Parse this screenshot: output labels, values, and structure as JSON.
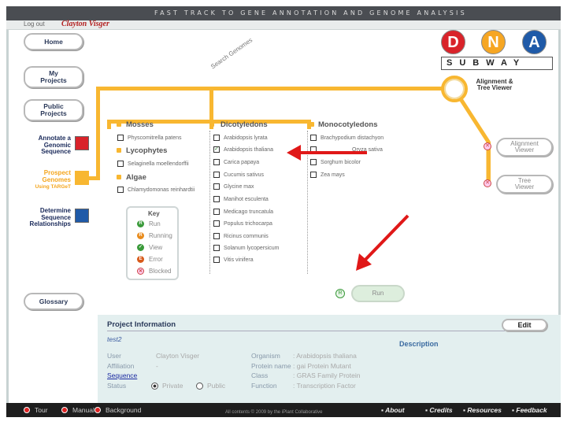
{
  "header": {
    "banner": "FAST TRACK TO GENE ANNOTATION AND GENOME ANALYSIS",
    "logout_label": "Log out",
    "username": "Clayton Visger"
  },
  "nav": {
    "home": "Home",
    "my_projects": "My Projects",
    "public_projects": "Public Projects",
    "glossary": "Glossary"
  },
  "tasks": {
    "annotate": "Annotate a Genomic Sequence",
    "prospect": "Prospect Genomes",
    "prospect_sub": "Using TARGeT",
    "determine": "Determine Sequence Relationships"
  },
  "logo": {
    "d": "D",
    "n": "N",
    "a": "A",
    "subway": "SUBWAY",
    "colors": {
      "d": "#d9232a",
      "n": "#f6a623",
      "a": "#1f5aa8"
    }
  },
  "search_genomes_label": "Search Genomes",
  "stations": {
    "alignment_tree": "Alignment & Tree Viewer",
    "alignment_viewer": "Alignment Viewer",
    "tree_viewer": "Tree Viewer"
  },
  "genomes": {
    "mosses": {
      "heading": "Mosses",
      "items": [
        {
          "label": "Physcomitrella patens",
          "checked": false
        }
      ]
    },
    "lycophytes": {
      "heading": "Lycophytes",
      "items": [
        {
          "label": "Selaginella moellendorffii",
          "checked": false
        }
      ]
    },
    "algae": {
      "heading": "Algae",
      "items": [
        {
          "label": "Chlamydomonas reinhardtii",
          "checked": false
        }
      ]
    },
    "dicotyledons": {
      "heading": "Dicotyledons",
      "items": [
        {
          "label": "Arabidopsis lyrata",
          "checked": false
        },
        {
          "label": "Arabidopsis thaliana",
          "checked": true
        },
        {
          "label": "Carica papaya",
          "checked": false
        },
        {
          "label": "Cucumis sativus",
          "checked": false
        },
        {
          "label": "Glycine max",
          "checked": false
        },
        {
          "label": "Manihot esculenta",
          "checked": false
        },
        {
          "label": "Medicago truncatula",
          "checked": false
        },
        {
          "label": "Populus trichocarpa",
          "checked": false
        },
        {
          "label": "Ricinus communis",
          "checked": false
        },
        {
          "label": "Solanum lycopersicum",
          "checked": false
        },
        {
          "label": "Vitis vinifera",
          "checked": false
        }
      ]
    },
    "monocotyledons": {
      "heading": "Monocotyledons",
      "items": [
        {
          "label": "Brachypodium distachyon",
          "checked": false
        },
        {
          "label": "Oryza sativa",
          "checked": false
        },
        {
          "label": "Sorghum bicolor",
          "checked": false
        },
        {
          "label": "Zea mays",
          "checked": false
        }
      ]
    }
  },
  "key": {
    "title": "Key",
    "run": "Run",
    "running": "Running",
    "view": "View",
    "error": "Error",
    "blocked": "Blocked"
  },
  "run_button": "Run",
  "project": {
    "section_title": "Project Information",
    "edit": "Edit",
    "name": "test2",
    "description_label": "Description",
    "user_label": "User",
    "user_value": "Clayton Visger",
    "affiliation_label": "Affiliation",
    "affiliation_value": "-",
    "sequence_label": "Sequence",
    "status_label": "Status",
    "status_private": "Private",
    "status_public": "Public",
    "organism_label": "Organism",
    "organism_value": ": Arabidopsis thaliana",
    "protein_label": "Protein name",
    "protein_value": ": gai Protein Mutant",
    "class_label": "Class",
    "class_value": ": GRAS Family Protein",
    "function_label": "Function",
    "function_value": ": Transcription Factor"
  },
  "footer": {
    "tour": "Tour",
    "manual": "Manual",
    "background": "Background",
    "copyright": "All contents © 2009 by the iPlant Collaborative",
    "about": "About",
    "credits": "Credits",
    "resources": "Resources",
    "feedback": "Feedback"
  }
}
